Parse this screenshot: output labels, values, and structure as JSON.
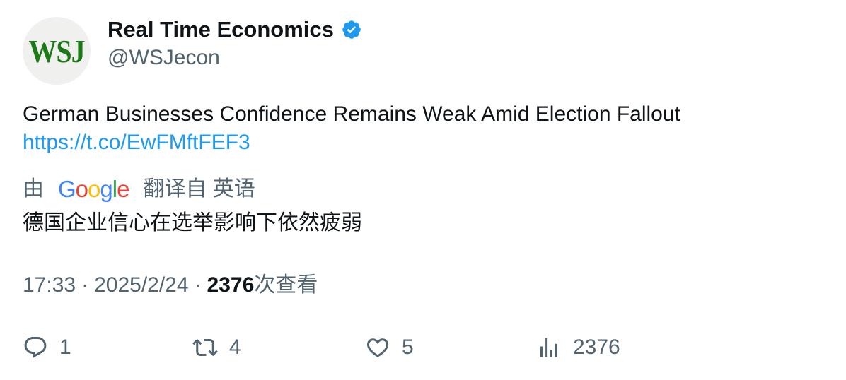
{
  "author": {
    "avatar_text": "WSJ",
    "display_name": "Real Time Economics",
    "handle": "@WSJecon",
    "verified_icon": "verified-badge-icon",
    "verified_color": "#1d9bf0"
  },
  "tweet": {
    "text": "German Businesses Confidence Remains Weak Amid Election Fallout",
    "link": "https://t.co/EwFMftFEF3"
  },
  "translation": {
    "prefix": "由",
    "provider": "Google",
    "suffix": "翻译自 英语",
    "text": "德国企业信心在选举影响下依然疲弱"
  },
  "meta": {
    "time": "17:33",
    "sep1": "·",
    "date": "2025/2/24",
    "sep2": "·",
    "views": "2376",
    "views_label": "次查看"
  },
  "actions": {
    "reply": {
      "icon": "reply-icon",
      "count": "1"
    },
    "retweet": {
      "icon": "retweet-icon",
      "count": "4"
    },
    "like": {
      "icon": "heart-icon",
      "count": "5"
    },
    "views": {
      "icon": "analytics-icon",
      "count": "2376"
    }
  },
  "colors": {
    "link": "#1d9bf0",
    "secondary_text": "#536471",
    "primary_text": "#0f1419",
    "brand_green": "#1e7a18"
  }
}
